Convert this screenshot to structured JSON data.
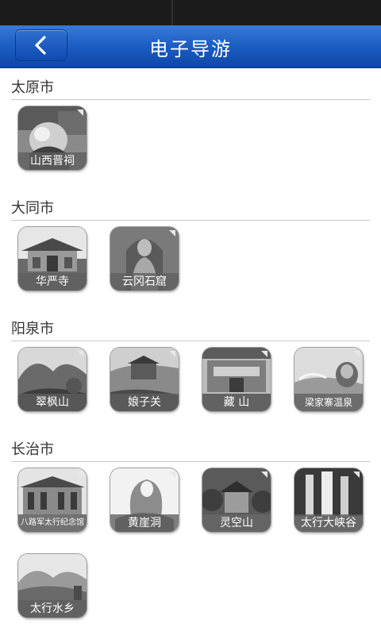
{
  "header": {
    "title": "电子导游",
    "back_icon": "chevron-left-icon"
  },
  "sections": [
    {
      "name": "太原市",
      "items": [
        "山西晋祠"
      ]
    },
    {
      "name": "大同市",
      "items": [
        "华严寺",
        "云冈石窟"
      ]
    },
    {
      "name": "阳泉市",
      "items": [
        "翠枫山",
        "娘子关",
        "藏 山",
        "梁家寨温泉"
      ]
    },
    {
      "name": "长治市",
      "items": [
        "八路军太行纪念馆",
        "黄崖洞",
        "灵空山",
        "太行大峡谷",
        "太行水乡"
      ]
    }
  ],
  "colors": {
    "accent": "#1d5fc4",
    "status_bar": "#1b1b1b"
  }
}
